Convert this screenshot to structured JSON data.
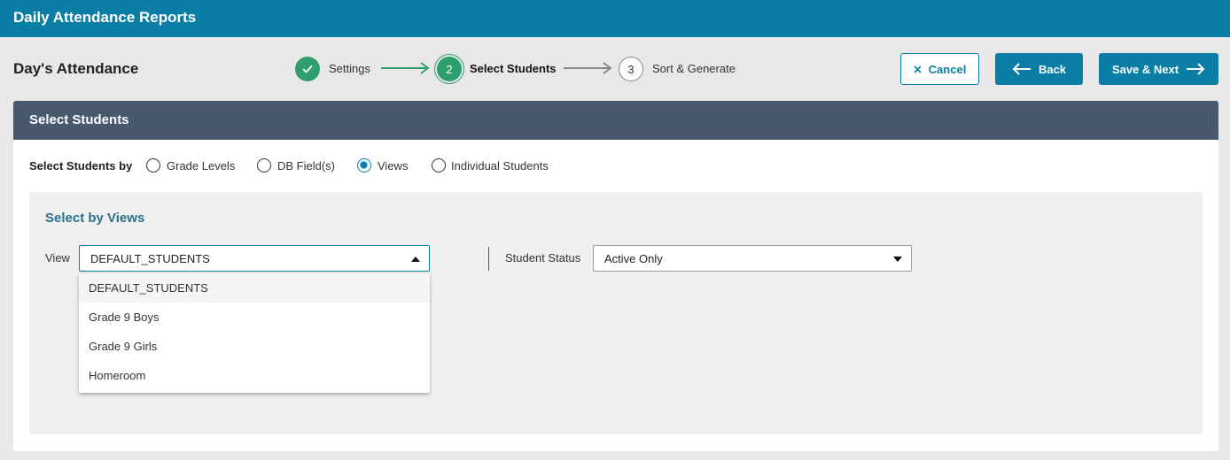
{
  "app": {
    "title": "Daily Attendance Reports"
  },
  "page": {
    "title": "Day's Attendance"
  },
  "stepper": {
    "steps": [
      {
        "number": "",
        "label": "Settings",
        "state": "complete"
      },
      {
        "number": "2",
        "label": "Select Students",
        "state": "current"
      },
      {
        "number": "3",
        "label": "Sort & Generate",
        "state": "upcoming"
      }
    ]
  },
  "actions": {
    "cancel_label": "Cancel",
    "back_label": "Back",
    "next_label": "Save & Next"
  },
  "panel": {
    "title": "Select Students"
  },
  "select_by": {
    "label": "Select Students by",
    "options": [
      {
        "label": "Grade Levels",
        "checked": false
      },
      {
        "label": "DB Field(s)",
        "checked": false
      },
      {
        "label": "Views",
        "checked": true
      },
      {
        "label": "Individual Students",
        "checked": false
      }
    ]
  },
  "views_section": {
    "title": "Select by Views",
    "view_label": "View",
    "view_value": "DEFAULT_STUDENTS",
    "view_options": [
      "DEFAULT_STUDENTS",
      "Grade 9 Boys",
      "Grade 9 Girls",
      "Homeroom"
    ],
    "status_label": "Student Status",
    "status_value": "Active Only"
  },
  "colors": {
    "header": "#0a7ea4",
    "panel_header": "#475a6d",
    "success": "#2e9e6e",
    "accent": "#0a7ea4"
  },
  "icons": {
    "step_complete": "check-icon",
    "cancel": "close-icon",
    "back": "arrow-left-icon",
    "next": "arrow-right-icon"
  }
}
